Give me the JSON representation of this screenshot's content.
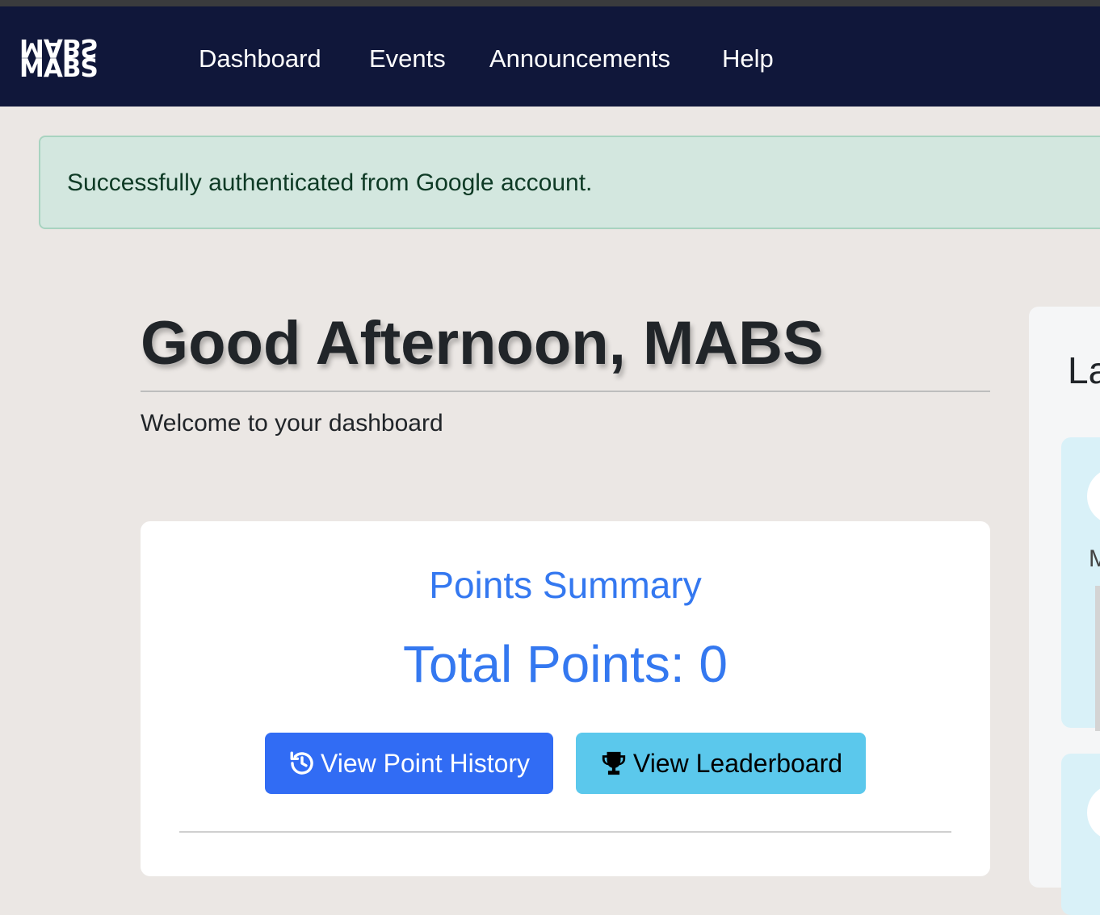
{
  "navbar": {
    "logo_text": "MABS",
    "links": [
      "Dashboard",
      "Events",
      "Announcements",
      "Help"
    ]
  },
  "alert": {
    "message": "Successfully authenticated from Google account."
  },
  "greeting": {
    "title": "Good Afternoon, MABS",
    "subtitle": "Welcome to your dashboard"
  },
  "points_card": {
    "title": "Points Summary",
    "total_label": "Total Points: 0",
    "history_button": "View Point History",
    "leaderboard_button": "View Leaderboard"
  },
  "side_panel": {
    "title_fragment": "La",
    "item_letter": "M"
  },
  "icons": [
    "history-icon",
    "trophy-icon"
  ],
  "colors": {
    "navbar": "#10173a",
    "primary": "#316cf4",
    "info": "#5bc8ec",
    "accent_text": "#3478f0",
    "alert_bg": "#d3e7df"
  }
}
